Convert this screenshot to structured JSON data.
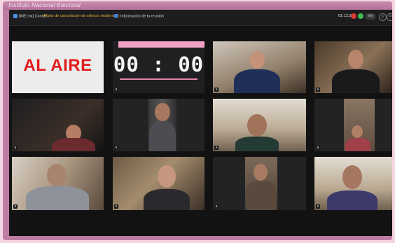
{
  "window": {
    "title_strip": "Instituto Nacional Electoral"
  },
  "topbar": {
    "meeting_name": "[INE.mx] Conse...",
    "meeting_status": "(Modo de cancelación de silencio moderado)",
    "meeting_info": "Información de la reunión",
    "elapsed_time": "01:12:33",
    "view_label": "Ver"
  },
  "tiles": {
    "on_air_text": "AL AIRE",
    "countdown": "00 : 00"
  },
  "colors": {
    "frame": "#c07da4",
    "on_air_red": "#e01c1c",
    "countdown_accent": "#f0a3c4"
  }
}
